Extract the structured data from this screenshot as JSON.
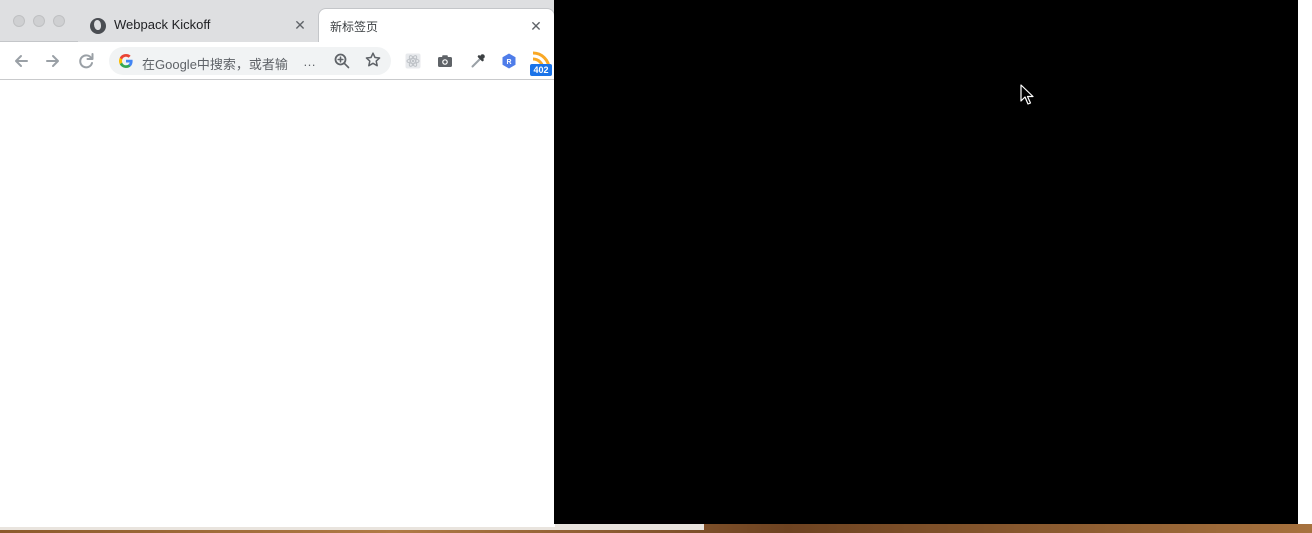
{
  "browser": {
    "tabs": [
      {
        "title": "Webpack Kickoff",
        "favicon": "globe-icon",
        "close": "✕"
      },
      {
        "title": "新标签页",
        "close": "✕"
      }
    ],
    "toolbar": {
      "back": "back-arrow-icon",
      "forward": "forward-arrow-icon",
      "reload": "reload-icon",
      "omnibox": {
        "value": "在Google中搜索，或者输",
        "ellipsis": "…",
        "search_engine_icon": "google-g-icon"
      },
      "zoom": "zoom-in-icon",
      "bookmark": "star-icon",
      "extensions": [
        {
          "name": "react-devtools-icon"
        },
        {
          "name": "camera-icon"
        },
        {
          "name": "eyedropper-icon"
        },
        {
          "name": "hexagon-r-icon",
          "letter": "R"
        },
        {
          "name": "rss-icon",
          "badge": "402"
        }
      ]
    }
  },
  "overlay": {
    "background": "#000000",
    "cursor": "mouse-pointer-icon"
  },
  "colors": {
    "tab_strip": "#dedfe1",
    "omnibox": "#f1f3f4",
    "badge": "#1a73e8"
  }
}
